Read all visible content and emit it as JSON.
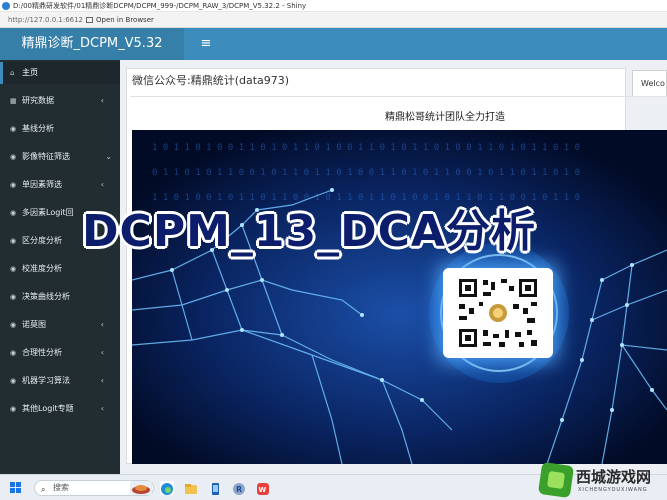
{
  "window": {
    "title": "D:/00精鼎研发软件/01精鼎诊断DCPM/DCPM_999-/DCPM_RAW_3/DCPM_V5.32.2 - Shiny"
  },
  "toolbar": {
    "url": "http://127.0.0.1:6612",
    "open_label": "Open in Browser"
  },
  "header": {
    "app_title": "精鼎诊断_DCPM_V5.32",
    "menu_icon": "hamburger-icon"
  },
  "sidebar": {
    "items": [
      {
        "label": "主页",
        "icon": "home-icon",
        "chevron": false,
        "active": true
      },
      {
        "label": "研究数据",
        "icon": "table-icon",
        "chevron": true
      },
      {
        "label": "基线分析",
        "icon": "eye-icon",
        "chevron": false
      },
      {
        "label": "影像特征筛选",
        "icon": "eye-icon",
        "chevron": true,
        "chevron_dir": "down"
      },
      {
        "label": "单因素筛选",
        "icon": "eye-icon",
        "chevron": true
      },
      {
        "label": "多因素Logit回",
        "icon": "eye-icon",
        "chevron": false
      },
      {
        "label": "区分度分析",
        "icon": "eye-icon",
        "chevron": true
      },
      {
        "label": "校准度分析",
        "icon": "eye-icon",
        "chevron": false
      },
      {
        "label": "决策曲线分析",
        "icon": "eye-icon",
        "chevron": false
      },
      {
        "label": "诺莫图",
        "icon": "eye-icon",
        "chevron": true
      },
      {
        "label": "合理性分析",
        "icon": "eye-icon",
        "chevron": true
      },
      {
        "label": "机器学习算法",
        "icon": "eye-icon",
        "chevron": true
      },
      {
        "label": "其他Logit专题",
        "icon": "eye-icon",
        "chevron": true
      }
    ]
  },
  "main": {
    "card_title": "微信公众号:精鼎统计(data973)",
    "card_subtitle": "精鼎松哥统计团队全力打造",
    "tab_label": "Welco",
    "banner_title": "DCPM_13_DCA分析"
  },
  "taskbar": {
    "search_placeholder": "搜索"
  },
  "watermark": {
    "text": "西城游戏网",
    "sub": "XICHENGYOUXIWANG"
  },
  "colors": {
    "header_bg": "#3c8dbc",
    "logo_bg": "#367fa9",
    "sidebar_bg": "#222d32",
    "banner_bg": "#03123a",
    "banner_title": "#0c1d6b"
  }
}
